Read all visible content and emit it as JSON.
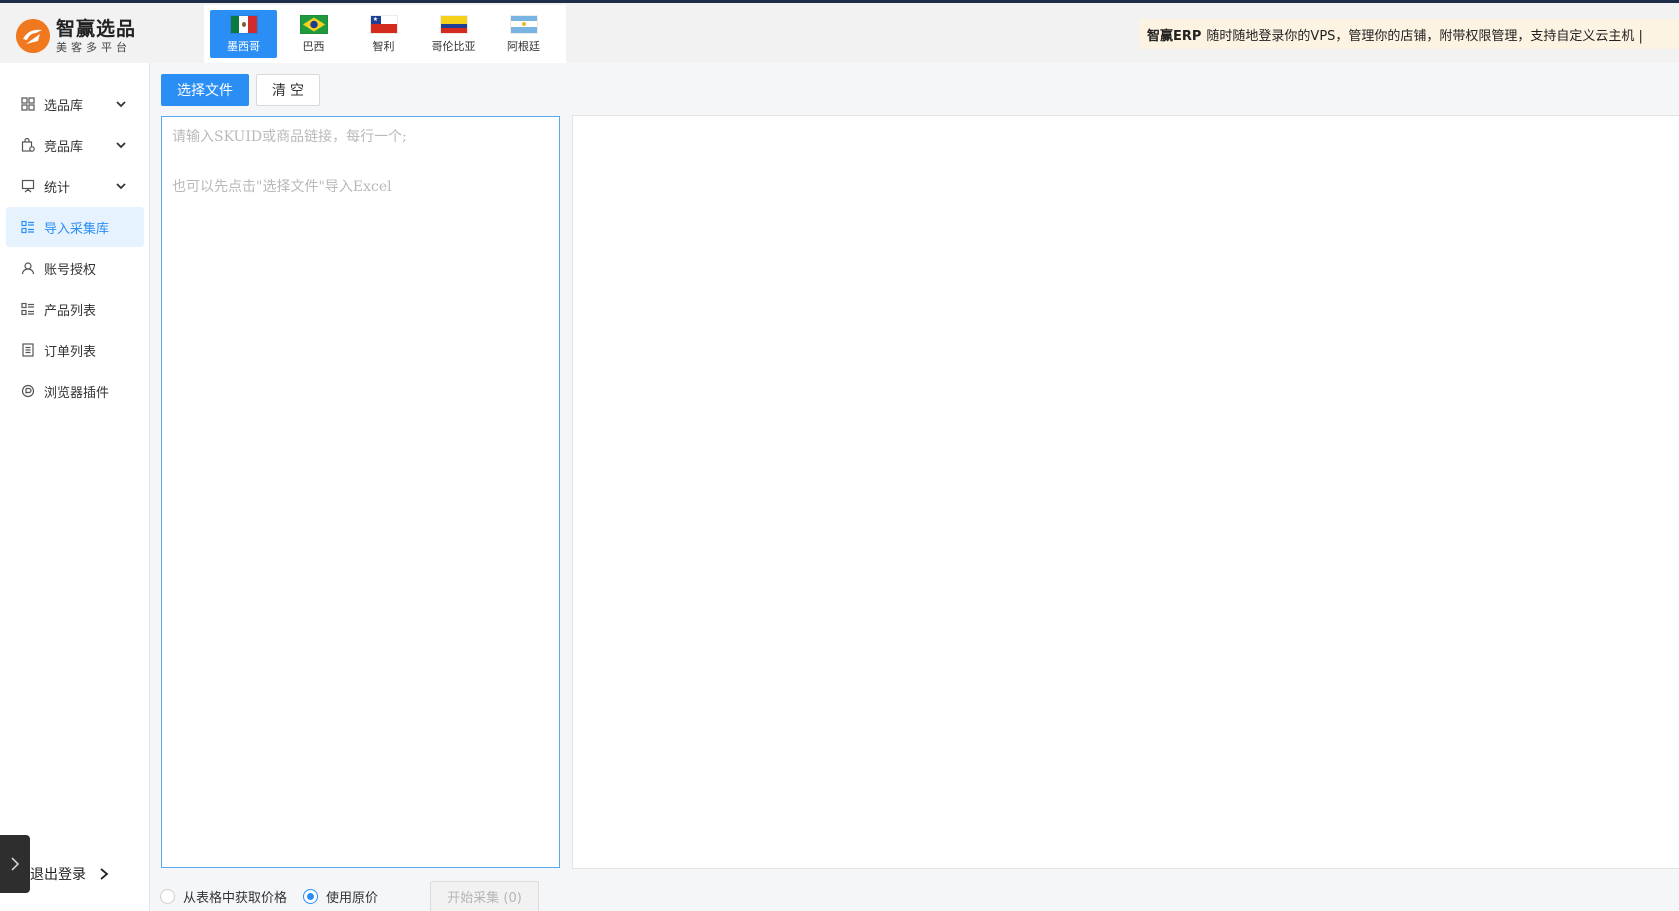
{
  "brand": {
    "title": "智赢选品",
    "subtitle": "美客多平台"
  },
  "countries": [
    {
      "label": "墨西哥",
      "active": true
    },
    {
      "label": "巴西",
      "active": false
    },
    {
      "label": "智利",
      "active": false
    },
    {
      "label": "哥伦比亚",
      "active": false
    },
    {
      "label": "阿根廷",
      "active": false
    }
  ],
  "announcement": {
    "strong": "智赢ERP",
    "text": "随时随地登录你的VPS，管理你的店铺，附带权限管理，支持自定义云主机 |"
  },
  "sidebar": {
    "items": [
      {
        "label": "选品库",
        "icon": "grid-icon",
        "expandable": true
      },
      {
        "label": "竞品库",
        "icon": "bag-icon",
        "expandable": true
      },
      {
        "label": "统计",
        "icon": "presentation-icon",
        "expandable": true
      },
      {
        "label": "导入采集库",
        "icon": "list-icon",
        "expandable": false,
        "active": true
      },
      {
        "label": "账号授权",
        "icon": "user-icon",
        "expandable": false
      },
      {
        "label": "产品列表",
        "icon": "list-icon",
        "expandable": false
      },
      {
        "label": "订单列表",
        "icon": "document-icon",
        "expandable": false
      },
      {
        "label": "浏览器插件",
        "icon": "plugin-icon",
        "expandable": false
      }
    ],
    "logout": "退出登录"
  },
  "toolbar": {
    "choose_file": "选择文件",
    "clear": "清空"
  },
  "sku_input": {
    "value": "",
    "placeholder": "请输入SKUID或商品链接，每行一个;\n\n也可以先点击\"选择文件\"导入Excel"
  },
  "options": {
    "price_from_table": "从表格中获取价格",
    "use_original_price": "使用原价",
    "selected": "use_original_price"
  },
  "start_button": "开始采集 (0)",
  "colors": {
    "primary": "#2a8ef5",
    "announce_bg": "#fdf3e3",
    "logo_orange": "#f0781e"
  }
}
